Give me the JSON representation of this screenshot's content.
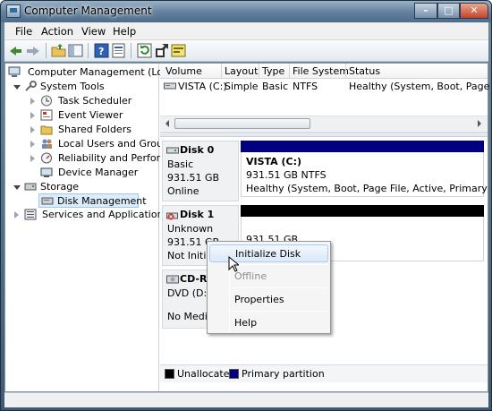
{
  "window": {
    "title": "Computer Management",
    "minimize_glyph": "–",
    "maximize_glyph": "□",
    "close_glyph": "✕"
  },
  "menu": [
    "File",
    "Action",
    "View",
    "Help"
  ],
  "toolbar": {
    "icons": [
      "back-arrow-icon",
      "forward-arrow-icon",
      "up-folder-icon",
      "show-hide-tree-icon",
      "help-icon",
      "properties-icon",
      "refresh-icon",
      "export-icon",
      "action-icon"
    ]
  },
  "tree": {
    "root": "Computer Management (Local",
    "system_tools": "System Tools",
    "task_scheduler": "Task Scheduler",
    "event_viewer": "Event Viewer",
    "shared_folders": "Shared Folders",
    "local_users": "Local Users and Groups",
    "reliability": "Reliability and Performa",
    "device_manager": "Device Manager",
    "storage": "Storage",
    "disk_management": "Disk Management",
    "services": "Services and Applications"
  },
  "volume_list": {
    "headers": [
      "Volume",
      "Layout",
      "Type",
      "File System",
      "Status"
    ],
    "rows": [
      [
        "VISTA (C:)",
        "Simple",
        "Basic",
        "NTFS",
        "Healthy (System, Boot, Page File,"
      ]
    ]
  },
  "disks": {
    "disk0": {
      "name": "Disk 0",
      "type": "Basic",
      "size": "931.51 GB",
      "state": "Online",
      "volume_name": "VISTA  (C:)",
      "volume_size": "931.51 GB NTFS",
      "volume_status": "Healthy (System, Boot, Page File, Active, Primary Partitic"
    },
    "disk1": {
      "name": "Disk 1",
      "type": "Unknown",
      "size": "931.51 GB",
      "state": "Not Initial",
      "volume_size": "931.51 GB"
    },
    "cdrom": {
      "name": "CD-RO",
      "type": "DVD (D:)",
      "state": "No Media"
    }
  },
  "legend": {
    "unallocated": "Unallocated",
    "primary": "Primary partition"
  },
  "context_menu": {
    "initialize": "Initialize Disk",
    "offline": "Offline",
    "properties": "Properties",
    "help": "Help"
  },
  "colors": {
    "primary_partition": "#000080",
    "unallocated": "#000000",
    "selection": "#dcecfb"
  }
}
